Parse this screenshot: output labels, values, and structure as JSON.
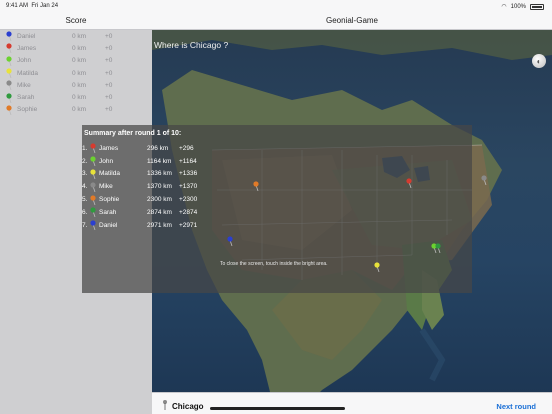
{
  "status_bar": {
    "time": "9:41 AM",
    "date": "Fri Jan 24",
    "battery": "100%"
  },
  "sidebar": {
    "title": "Score",
    "rows": [
      {
        "name": "Daniel",
        "km": "0 km",
        "pts": "+0",
        "color": "#2b3fd0"
      },
      {
        "name": "James",
        "km": "0 km",
        "pts": "+0",
        "color": "#d63b2f"
      },
      {
        "name": "John",
        "km": "0 km",
        "pts": "+0",
        "color": "#6cd230"
      },
      {
        "name": "Matilda",
        "km": "0 km",
        "pts": "+0",
        "color": "#e8e23a"
      },
      {
        "name": "Mike",
        "km": "0 km",
        "pts": "+0",
        "color": "#8a8a8a"
      },
      {
        "name": "Sarah",
        "km": "0 km",
        "pts": "+0",
        "color": "#2f9a3e"
      },
      {
        "name": "Sophie",
        "km": "0 km",
        "pts": "+0",
        "color": "#e07a28"
      }
    ]
  },
  "navbar": {
    "title": "Geonial-Game"
  },
  "question": "Where is Chicago ?",
  "summary": {
    "title": "Summary after round 1 of 10:",
    "rows": [
      {
        "rank": "1.",
        "name": "James",
        "km": "296 km",
        "pts": "+296",
        "color": "#d63b2f"
      },
      {
        "rank": "2.",
        "name": "John",
        "km": "1164 km",
        "pts": "+1164",
        "color": "#6cd230"
      },
      {
        "rank": "3.",
        "name": "Matilda",
        "km": "1336 km",
        "pts": "+1336",
        "color": "#e8e23a"
      },
      {
        "rank": "4.",
        "name": "Mike",
        "km": "1370 km",
        "pts": "+1370",
        "color": "#8a8a8a"
      },
      {
        "rank": "5.",
        "name": "Sophie",
        "km": "2300 km",
        "pts": "+2300",
        "color": "#e07a28"
      },
      {
        "rank": "6.",
        "name": "Sarah",
        "km": "2874 km",
        "pts": "+2874",
        "color": "#2f9a3e"
      },
      {
        "rank": "7.",
        "name": "Daniel",
        "km": "2971 km",
        "pts": "+2971",
        "color": "#2b3fd0"
      }
    ],
    "close_hint": "To close the screen, touch inside the bright area."
  },
  "bottom_bar": {
    "city": "Chicago",
    "next_round": "Next round"
  },
  "map_pins": [
    {
      "name": "James",
      "color": "#d63b2f"
    },
    {
      "name": "John",
      "color": "#6cd230"
    },
    {
      "name": "Matilda",
      "color": "#e8e23a"
    },
    {
      "name": "Mike",
      "color": "#8a8a8a"
    },
    {
      "name": "Sophie",
      "color": "#e07a28"
    },
    {
      "name": "Sarah",
      "color": "#2f9a3e"
    },
    {
      "name": "Daniel",
      "color": "#2b3fd0"
    }
  ]
}
